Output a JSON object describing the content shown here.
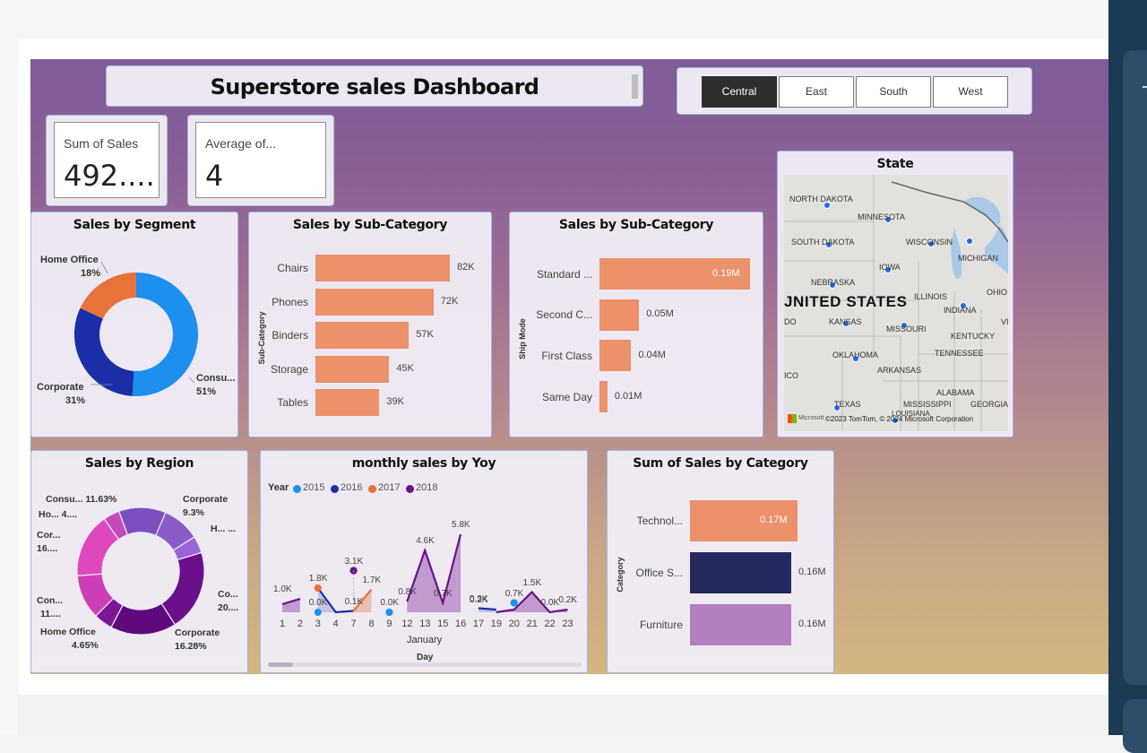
{
  "dashboard_title": "Superstore sales Dashboard",
  "region_slicer": {
    "options": [
      "Central",
      "East",
      "South",
      "West"
    ],
    "selected": "Central"
  },
  "kpis": {
    "sum_of_sales": {
      "label": "Sum of Sales",
      "value": "492...."
    },
    "average": {
      "label": "Average of...",
      "value": "4"
    }
  },
  "sales_by_segment": {
    "title": "Sales by Segment",
    "slices": [
      {
        "name": "Home Office",
        "pct": "18%",
        "value": 18,
        "color": "#e7733a"
      },
      {
        "name": "Consu...",
        "pct": "51%",
        "value": 51,
        "color": "#1d8fef"
      },
      {
        "name": "Corporate",
        "pct": "31%",
        "value": 31,
        "color": "#1a2ea8"
      }
    ]
  },
  "sales_by_subcategory": {
    "title": "Sales by Sub-Category",
    "axis_label": "Sub-Category",
    "categories": [
      "Chairs",
      "Phones",
      "Binders",
      "Storage",
      "Tables"
    ],
    "values": [
      82,
      72,
      57,
      45,
      39
    ],
    "value_labels": [
      "82K",
      "72K",
      "57K",
      "45K",
      "39K"
    ]
  },
  "sales_by_shipmode": {
    "title": "Sales by Sub-Category",
    "axis_label": "Ship Mode",
    "categories": [
      "Standard ...",
      "Second C...",
      "First Class",
      "Same Day"
    ],
    "values": [
      0.19,
      0.05,
      0.04,
      0.01
    ],
    "value_labels": [
      "0.19M",
      "0.05M",
      "0.04M",
      "0.01M"
    ]
  },
  "state_map": {
    "title": "State",
    "country_label": "JNITED STATES",
    "states": [
      "NORTH DAKOTA",
      "MINNESOTA",
      "SOUTH DAKOTA",
      "WISCONSIN",
      "MICHIGAN",
      "IOWA",
      "NEBRASKA",
      "ILLINOIS",
      "OHIO",
      "INDIANA",
      "KANSAS",
      "MISSOURI",
      "KENTUCKY",
      "OKLAHOMA",
      "TENNESSEE",
      "ARKANSAS",
      "ALABAMA",
      "TEXAS",
      "MISSISSIPPI",
      "GEORGIA",
      "LOUISIANA",
      "DO",
      "ICO",
      "VI"
    ],
    "attribution": "©2023 TomTom, © 2024 Microsoft Corporation",
    "logo_text": "Microsoft"
  },
  "sales_by_region": {
    "title": "Sales by Region",
    "labels": {
      "consu_top": "Consu... 11.63%",
      "corporate_tr": "Corporate",
      "corporate_tr_pct": "9.3%",
      "ho_left": "Ho... 4....",
      "h_right": "H... ...",
      "cor_left": "Cor...",
      "cor_left_pct": "16....",
      "con_left": "Con...",
      "con_left_pct": "11....",
      "co_right": "Co...",
      "co_right_pct": "20....",
      "home_office_bottom": "Home Office",
      "home_office_bottom_pct": "4.65%",
      "corporate_bottom": "Corporate",
      "corporate_bottom_pct": "16.28%"
    },
    "slices": [
      {
        "value": 11.63,
        "color": "#7a4fbf"
      },
      {
        "value": 9.3,
        "color": "#8a5cc8"
      },
      {
        "value": 4.2,
        "color": "#9b64d6"
      },
      {
        "value": 20.0,
        "color": "#6b0f8a"
      },
      {
        "value": 16.28,
        "color": "#5e0a7c"
      },
      {
        "value": 4.65,
        "color": "#7b1696"
      },
      {
        "value": 11.0,
        "color": "#cc3fb6"
      },
      {
        "value": 16.0,
        "color": "#dd48bd"
      },
      {
        "value": 4.0,
        "color": "#c34ab8"
      }
    ]
  },
  "monthly_sales": {
    "title": "monthly sales by Yoy",
    "legend_title": "Year",
    "legend": [
      {
        "name": "2015",
        "color": "#1d8fef"
      },
      {
        "name": "2016",
        "color": "#1a2ea8"
      },
      {
        "name": "2017",
        "color": "#e7733a"
      },
      {
        "name": "2018",
        "color": "#6b0f8a"
      }
    ],
    "x_ticks": [
      "1",
      "2",
      "3",
      "4",
      "7",
      "8",
      "9",
      "12",
      "13",
      "15",
      "16",
      "17",
      "19",
      "20",
      "21",
      "22",
      "23"
    ],
    "x_group_label": "January",
    "x_axis_title": "Day",
    "data_labels": [
      "1.0K",
      "1.8K",
      "0.0K",
      "3.1K",
      "1.7K",
      "0.1K",
      "0.0K",
      "0.8K",
      "4.6K",
      "0.7K",
      "5.8K",
      "0.3K",
      "0.2K",
      "0.7K",
      "1.5K",
      "0.0K",
      "0.2K"
    ]
  },
  "chart_data": [
    {
      "type": "pie",
      "title": "Sales by Segment",
      "categories": [
        "Consu...",
        "Corporate",
        "Home Office"
      ],
      "values": [
        51,
        31,
        18
      ]
    },
    {
      "type": "bar",
      "title": "Sales by Sub-Category",
      "ylabel": "Sub-Category",
      "categories": [
        "Chairs",
        "Phones",
        "Binders",
        "Storage",
        "Tables"
      ],
      "values": [
        82000,
        72000,
        57000,
        45000,
        39000
      ]
    },
    {
      "type": "bar",
      "title": "Sales by Sub-Category",
      "ylabel": "Ship Mode",
      "categories": [
        "Standard ...",
        "Second C...",
        "First Class",
        "Same Day"
      ],
      "values": [
        190000,
        50000,
        40000,
        10000
      ]
    },
    {
      "type": "pie",
      "title": "Sales by Region",
      "categories": [
        "Consu...",
        "Corporate",
        "H...",
        "Co...",
        "Corporate",
        "Home Office",
        "Con...",
        "Cor...",
        "Ho..."
      ],
      "values": [
        11.63,
        9.3,
        4.2,
        20.0,
        16.28,
        4.65,
        11.0,
        16.0,
        4.0
      ]
    },
    {
      "type": "area",
      "title": "monthly sales by Yoy",
      "xlabel": "Day",
      "x": [
        "1",
        "2",
        "3",
        "4",
        "7",
        "8",
        "9",
        "12",
        "13",
        "15",
        "16",
        "17",
        "19",
        "20",
        "21",
        "22",
        "23"
      ],
      "series": [
        {
          "name": "2015",
          "values": [
            null,
            null,
            0.0,
            null,
            null,
            null,
            0.0,
            null,
            null,
            null,
            null,
            null,
            null,
            0.7,
            null,
            null,
            null
          ]
        },
        {
          "name": "2016",
          "values": [
            null,
            null,
            1.8,
            0.0,
            0.1,
            null,
            null,
            null,
            null,
            null,
            null,
            0.3,
            0.2,
            null,
            null,
            null,
            null
          ]
        },
        {
          "name": "2017",
          "values": [
            null,
            null,
            1.8,
            null,
            0.1,
            1.7,
            null,
            null,
            null,
            null,
            null,
            null,
            null,
            null,
            null,
            null,
            null
          ]
        },
        {
          "name": "2018",
          "values": [
            0.6,
            1.0,
            null,
            null,
            3.1,
            null,
            null,
            0.8,
            4.6,
            0.7,
            5.8,
            null,
            0.0,
            0.2,
            1.5,
            0.0,
            0.2
          ]
        }
      ]
    },
    {
      "type": "bar",
      "title": "Sum of Sales by Category",
      "ylabel": "Category",
      "categories": [
        "Technol...",
        "Office S...",
        "Furniture"
      ],
      "values": [
        170000,
        160000,
        160000
      ]
    }
  ],
  "sales_by_category": {
    "title": "Sum of Sales by Category",
    "axis_label": "Category",
    "categories": [
      "Technol...",
      "Office S...",
      "Furniture"
    ],
    "values": [
      0.17,
      0.16,
      0.16
    ],
    "value_labels": [
      "0.17M",
      "0.16M",
      "0.16M"
    ],
    "colors": [
      "#ec916a",
      "#25295e",
      "#b37fc0"
    ]
  }
}
